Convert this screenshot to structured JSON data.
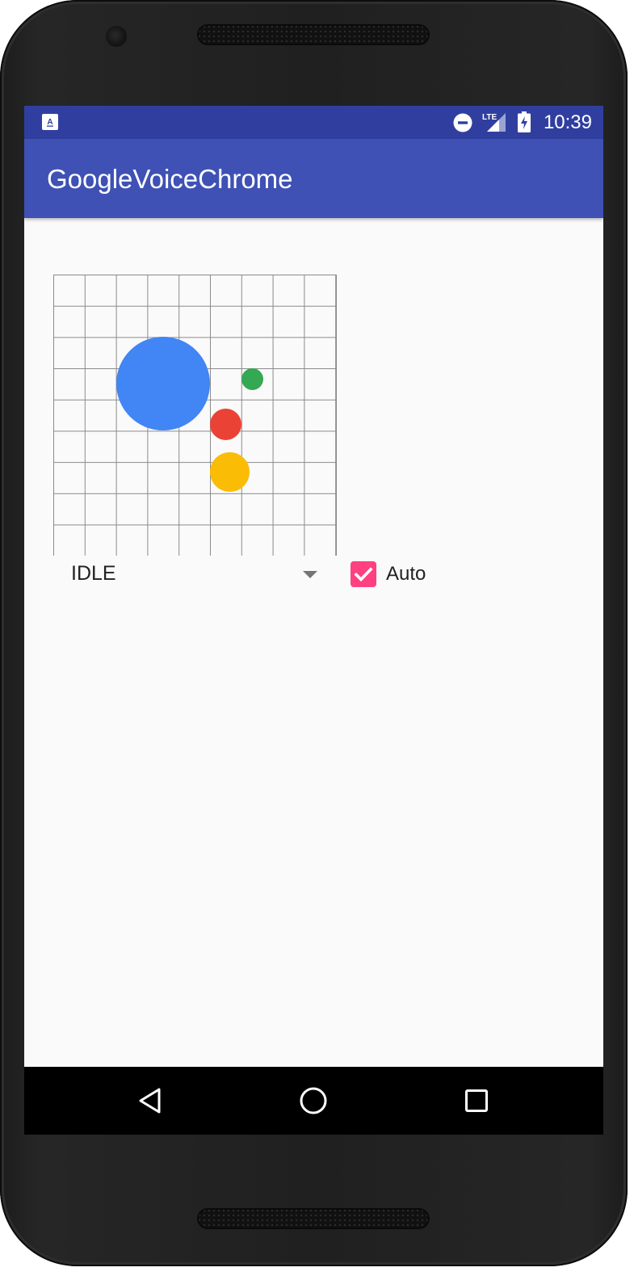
{
  "status_bar": {
    "time": "10:39",
    "network_label": "LTE",
    "icons": [
      "app-notification-icon",
      "do-not-disturb-icon",
      "signal-icon",
      "battery-charging-icon"
    ]
  },
  "app_bar": {
    "title": "GoogleVoiceChrome"
  },
  "visualizer": {
    "dots": [
      {
        "name": "blue-dot",
        "color": "#4285f4"
      },
      {
        "name": "green-dot",
        "color": "#34a853"
      },
      {
        "name": "red-dot",
        "color": "#ea4335"
      },
      {
        "name": "yellow-dot",
        "color": "#fbbc05"
      }
    ]
  },
  "controls": {
    "state_select_value": "IDLE",
    "auto_checked": true,
    "auto_label": "Auto",
    "accent_color": "#ff4081"
  },
  "nav_bar": {
    "icons": [
      "back-icon",
      "home-icon",
      "recents-icon"
    ]
  },
  "colors": {
    "status_bar": "#303f9f",
    "app_bar": "#3f51b5",
    "background": "#fafafa"
  }
}
